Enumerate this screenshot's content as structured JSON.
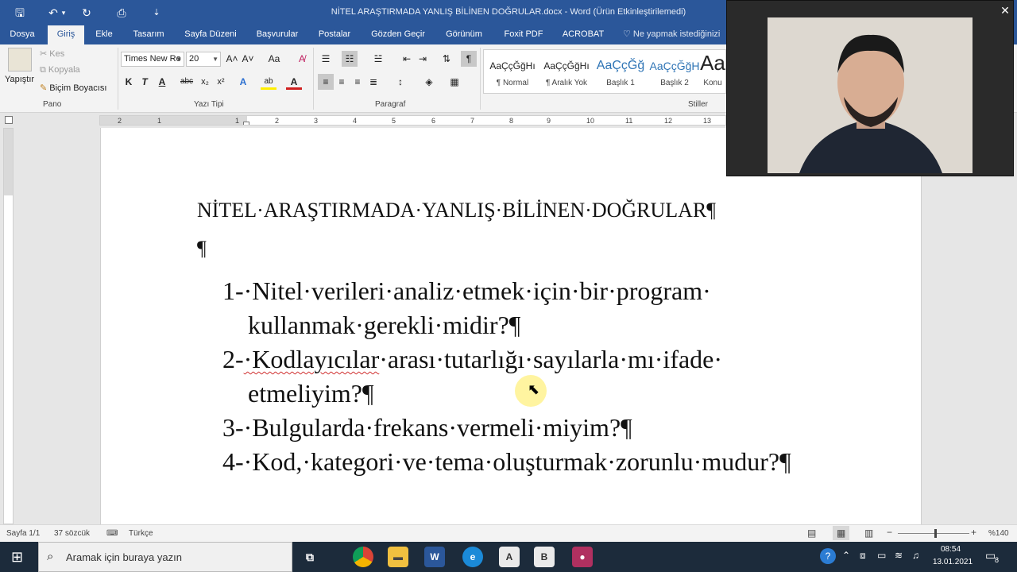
{
  "window": {
    "title": "NİTEL ARAŞTIRMADA YANLIŞ BİLİNEN DOĞRULAR.docx - Word (Ürün Etkinleştirilemedi)",
    "quick_access": {
      "save": "🖫",
      "undo": "↶",
      "undo_more": "▾",
      "redo": "↻",
      "preview": "⎙",
      "customize": "⇣"
    }
  },
  "tabs": [
    "Dosya",
    "Giriş",
    "Ekle",
    "Tasarım",
    "Sayfa Düzeni",
    "Başvurular",
    "Postalar",
    "Gözden Geçir",
    "Görünüm",
    "Foxit PDF",
    "ACROBAT"
  ],
  "tell_me": "Ne yapmak istediğinizi",
  "ribbon": {
    "clipboard": {
      "paste": "Yapıştır",
      "cut": "Kes",
      "copy": "Kopyala",
      "format_painter": "Biçim Boyacısı",
      "group": "Pano"
    },
    "font": {
      "name": "Times New Ro",
      "size": "20",
      "group": "Yazı Tipi",
      "bold": "K",
      "italic": "T",
      "underline": "A",
      "strike": "abc",
      "sub": "x₂",
      "sup": "x²",
      "grow": "A˄",
      "shrink": "A˅",
      "case": "Aa",
      "clear": "A̸",
      "effects": "A",
      "highlight": "ab",
      "color": "A"
    },
    "paragraph": {
      "group": "Paragraf",
      "pilcrow": "¶"
    },
    "styles": {
      "group": "Stiller",
      "items": [
        {
          "preview": "AaÇçĞğHı",
          "name": "¶ Normal"
        },
        {
          "preview": "AaÇçĞğHı",
          "name": "¶ Aralık Yok"
        },
        {
          "preview": "AaÇçĞğ",
          "name": "Başlık 1"
        },
        {
          "preview": "AaÇçĞğH",
          "name": "Başlık 2"
        },
        {
          "preview": "Aa",
          "name": "Konu"
        }
      ]
    }
  },
  "ruler": {
    "ticks": [
      "2",
      "1",
      "1",
      "2",
      "3",
      "4",
      "5",
      "6",
      "7",
      "8",
      "9",
      "10",
      "11",
      "12",
      "13"
    ]
  },
  "document": {
    "heading": "NİTEL·ARAŞTIRMADA·YANLIŞ·BİLİNEN·DOĞRULAR¶",
    "empty_par": "¶",
    "items": [
      {
        "num": "1-",
        "line1": "·Nitel·verileri·analiz·etmek·için·bir·program·",
        "line2": "kullanmak·gerekli·midir?¶"
      },
      {
        "num": "2-",
        "squiggle": "·Kodlayıcılar",
        "line1_rest": "·arası·tutarlığı·sayılarla·mı·ifade·",
        "line2": "etmeliyim?¶"
      },
      {
        "num": "3-",
        "line1": "·Bulgularda·frekans·vermeli·miyim?¶"
      },
      {
        "num": "4-",
        "line1": "·Kod,·kategori·ve·tema·oluşturmak·zorunlu·mudur?¶"
      }
    ]
  },
  "status": {
    "page": "Sayfa 1/1",
    "words": "37 sözcük",
    "language": "Türkçe",
    "zoom": "%140"
  },
  "taskbar": {
    "search_placeholder": "Aramak için buraya yazın",
    "time": "08:54",
    "date": "13.01.2021",
    "notifications": "8"
  }
}
